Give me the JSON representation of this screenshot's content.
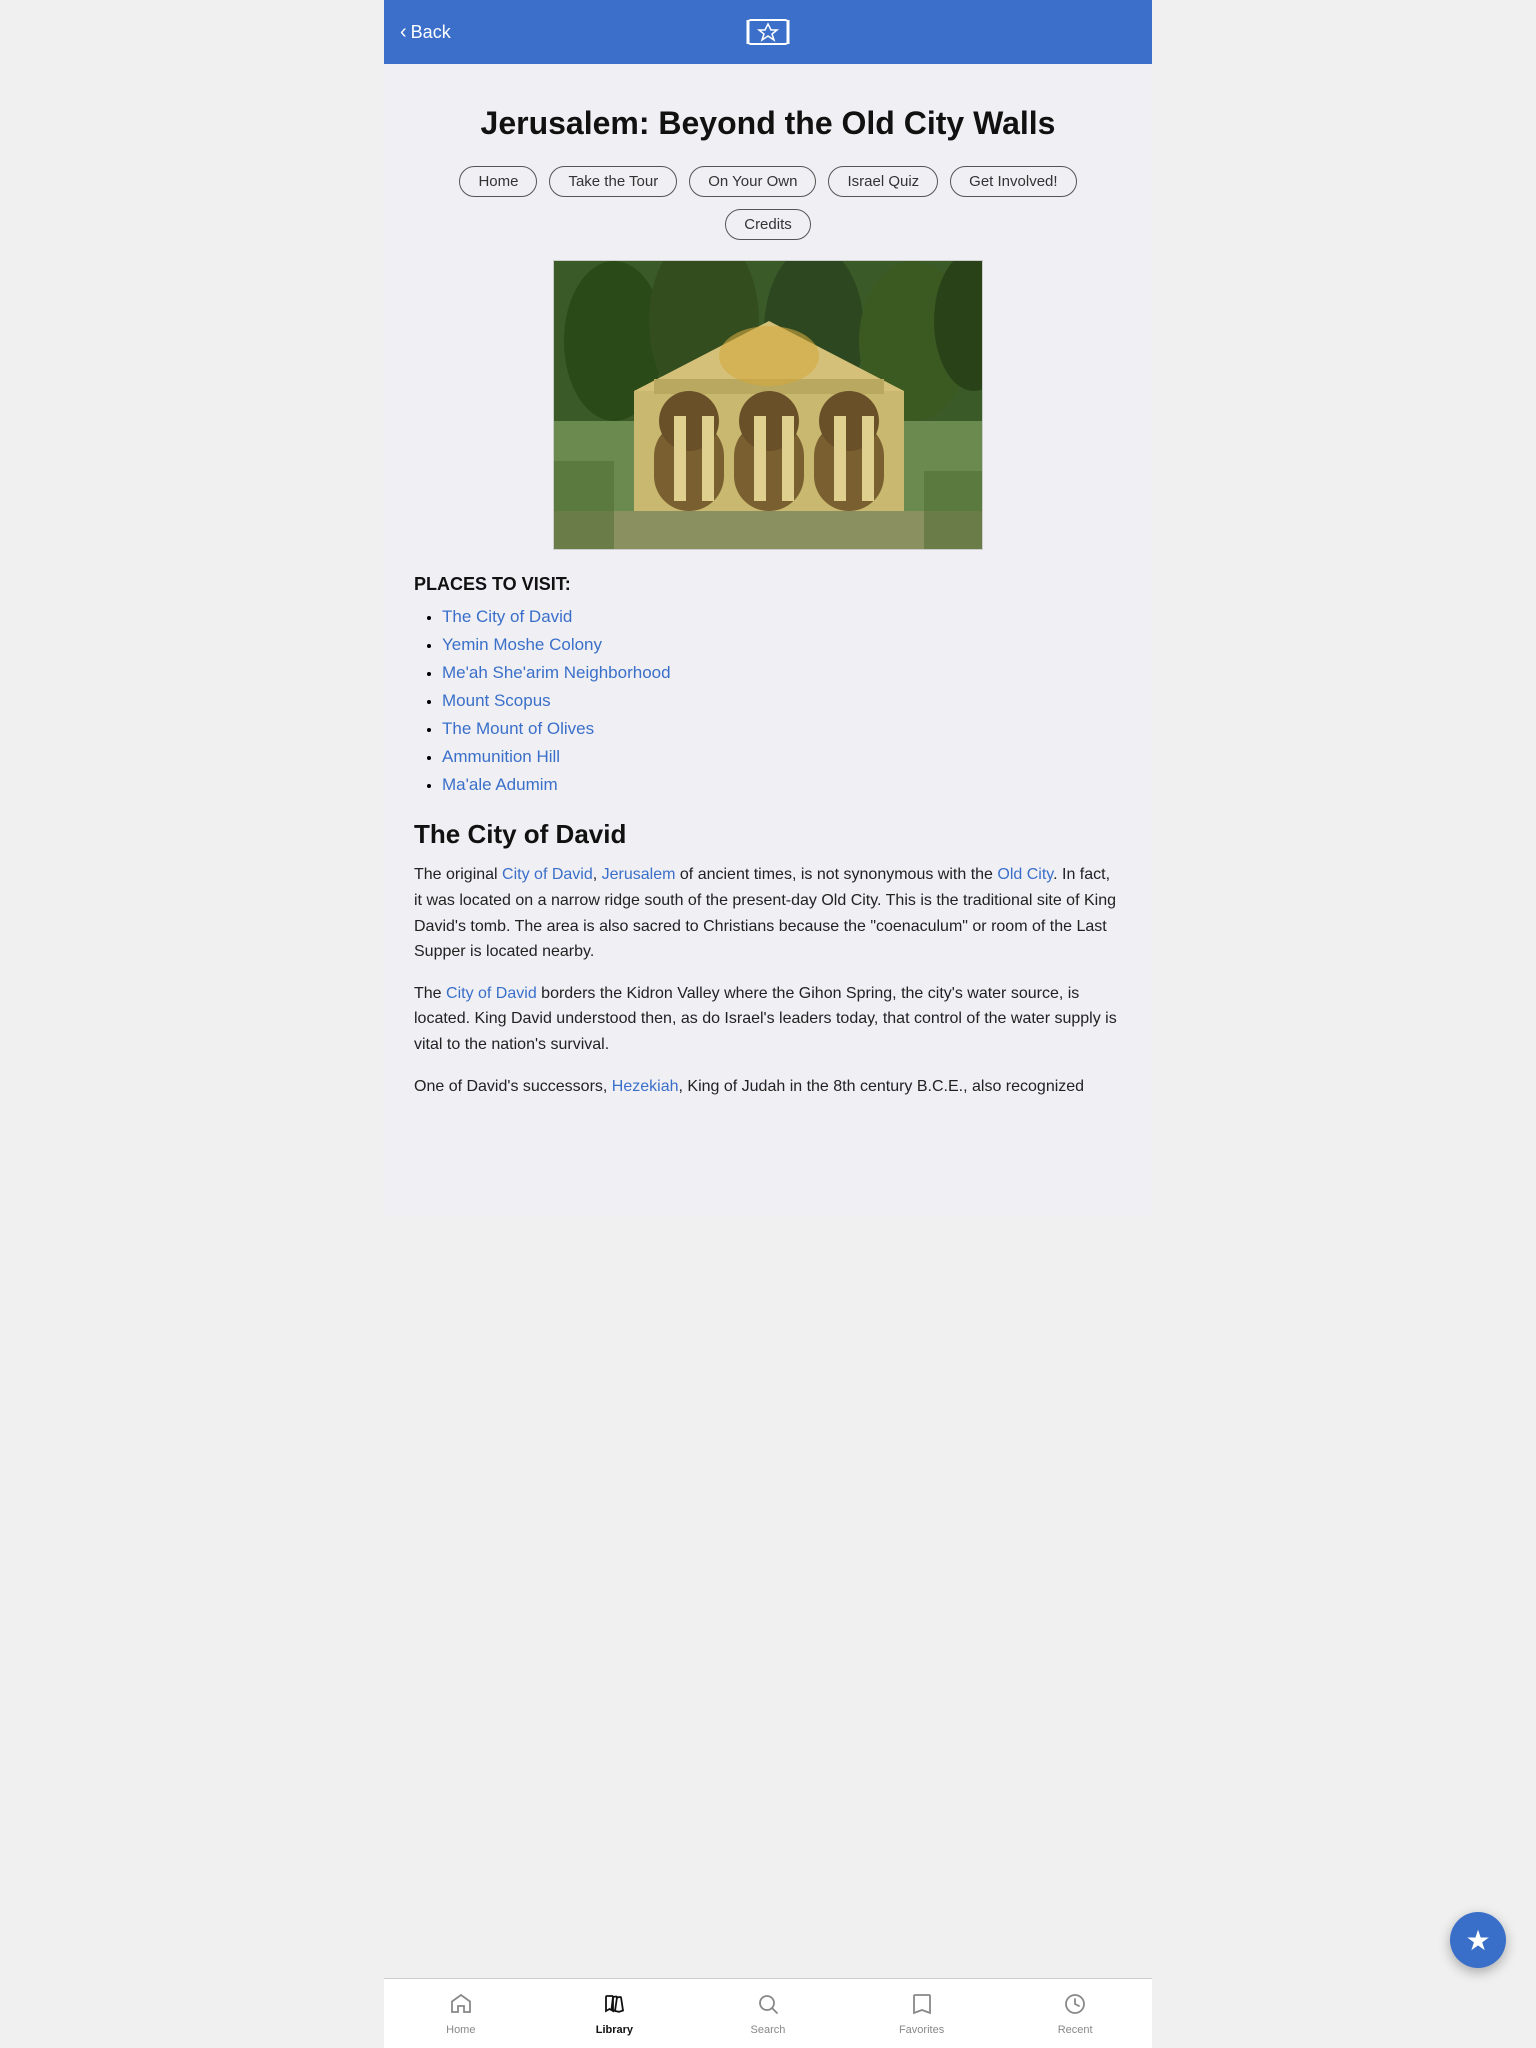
{
  "header": {
    "back_label": "Back"
  },
  "page": {
    "title": "Jerusalem: Beyond the Old City Walls"
  },
  "nav_buttons": [
    {
      "id": "home",
      "label": "Home"
    },
    {
      "id": "take-the-tour",
      "label": "Take the Tour"
    },
    {
      "id": "on-your-own",
      "label": "On Your Own"
    },
    {
      "id": "israel-quiz",
      "label": "Israel Quiz"
    },
    {
      "id": "get-involved",
      "label": "Get Involved!"
    }
  ],
  "credits_button": "Credits",
  "places_section_label": "PLACES TO VISIT:",
  "places": [
    {
      "label": "The City of David",
      "href": "#city-of-david"
    },
    {
      "label": "Yemin Moshe Colony",
      "href": "#yemin-moshe"
    },
    {
      "label": "Me'ah She'arim Neighborhood",
      "href": "#meah-shearim"
    },
    {
      "label": "Mount Scopus",
      "href": "#mount-scopus"
    },
    {
      "label": "The Mount of Olives",
      "href": "#mount-olives"
    },
    {
      "label": "Ammunition Hill",
      "href": "#ammunition-hill"
    },
    {
      "label": "Ma'ale Adumim",
      "href": "#maale-adumim"
    }
  ],
  "article": {
    "title": "The City of David",
    "paragraphs": [
      {
        "id": "p1",
        "text_parts": [
          {
            "text": "The original ",
            "type": "plain"
          },
          {
            "text": "City of David",
            "type": "link"
          },
          {
            "text": ", ",
            "type": "plain"
          },
          {
            "text": "Jerusalem",
            "type": "link"
          },
          {
            "text": " of ancient times, is not synonymous with the ",
            "type": "plain"
          },
          {
            "text": "Old City",
            "type": "link"
          },
          {
            "text": ". In fact, it was located on a narrow ridge south of the present-day Old City. This is the traditional site of King David's tomb. The area is also sacred to Christians because the \"coenaculum\" or room of the Last Supper is located nearby.",
            "type": "plain"
          }
        ]
      },
      {
        "id": "p2",
        "text_parts": [
          {
            "text": "The ",
            "type": "plain"
          },
          {
            "text": "City of David",
            "type": "link"
          },
          {
            "text": " borders the Kidron Valley where the Gihon Spring, the city's water source, is located. King David understood then, as do Israel's leaders today, that control of the water supply is vital to the nation's survival.",
            "type": "plain"
          }
        ]
      },
      {
        "id": "p3",
        "text_parts": [
          {
            "text": "One of David's successors, ",
            "type": "plain"
          },
          {
            "text": "Hezekiah",
            "type": "link"
          },
          {
            "text": ", King of Judah in the 8th century B.C.E., also recognized",
            "type": "plain"
          }
        ]
      }
    ]
  },
  "bottom_tabs": [
    {
      "id": "home",
      "label": "Home",
      "icon": "house",
      "active": false
    },
    {
      "id": "library",
      "label": "Library",
      "icon": "book",
      "active": true
    },
    {
      "id": "search",
      "label": "Search",
      "icon": "magnifier",
      "active": false
    },
    {
      "id": "favorites",
      "label": "Favorites",
      "icon": "bookmark",
      "active": false
    },
    {
      "id": "recent",
      "label": "Recent",
      "icon": "clock",
      "active": false
    }
  ]
}
